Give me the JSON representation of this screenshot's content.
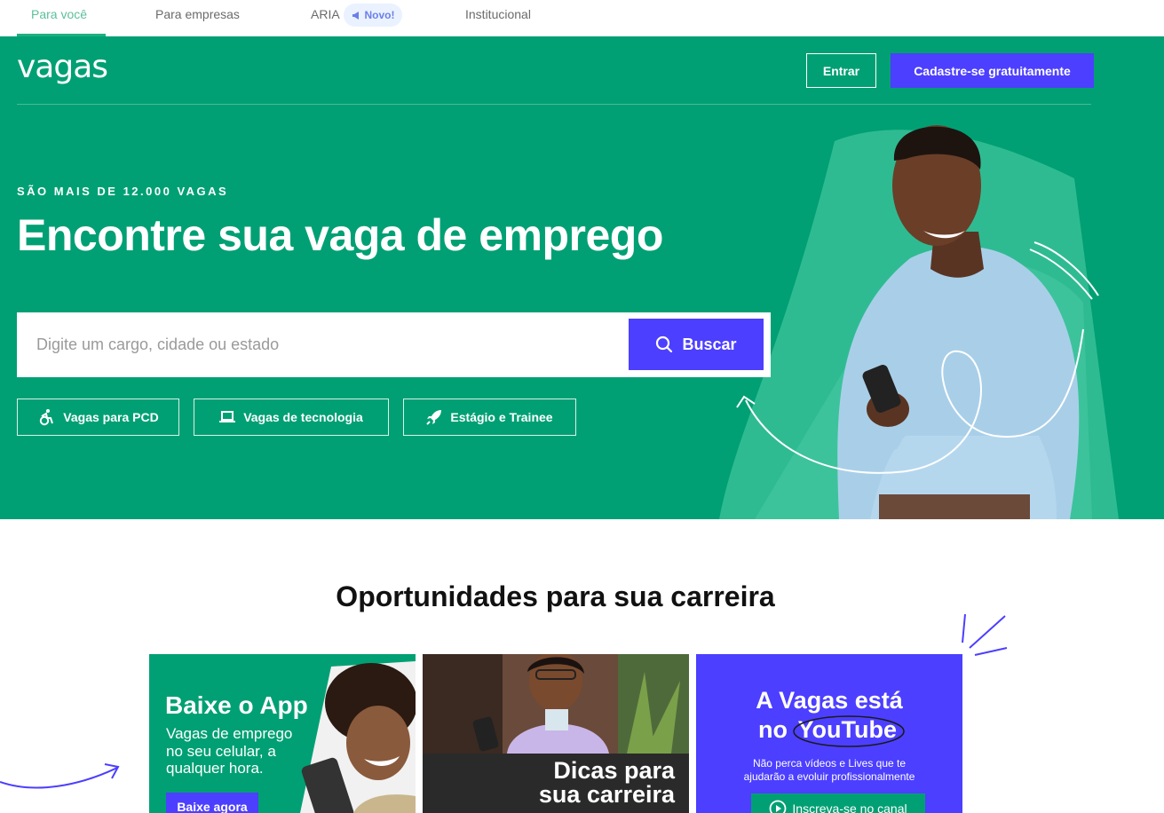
{
  "topnav": {
    "items": [
      "Para você",
      "Para empresas",
      "ARIA",
      "Institucional"
    ],
    "badge": "Novo!"
  },
  "header": {
    "logo": "vagas",
    "login": "Entrar",
    "signup": "Cadastre-se gratuitamente"
  },
  "hero": {
    "eyebrow": "SÃO MAIS DE 12.000 VAGAS",
    "headline": "Encontre sua vaga de emprego",
    "search_placeholder": "Digite um cargo, cidade ou estado",
    "search_button": "Buscar",
    "chips": [
      "Vagas para PCD",
      "Vagas de tecnologia",
      "Estágio e Trainee"
    ]
  },
  "opportunities": {
    "title": "Oportunidades para sua carreira",
    "app_card": {
      "title": "Baixe o App",
      "text": "Vagas de emprego no seu celular, a qualquer hora.",
      "button": "Baixe agora"
    },
    "tips_card": {
      "title_line1": "Dicas para",
      "title_line2": "sua carreira"
    },
    "youtube_card": {
      "title_line1": "A Vagas está",
      "title_prefix": "no",
      "title_highlight": "YouTube",
      "text_line1": "Não perca vídeos e Lives que te",
      "text_line2": "ajudarão a evoluir profissionalmente",
      "button": "Inscreva-se no canal"
    }
  },
  "colors": {
    "brand_green": "#00a074",
    "brand_purple": "#4c3fff",
    "nav_active": "#5dbf9a"
  }
}
